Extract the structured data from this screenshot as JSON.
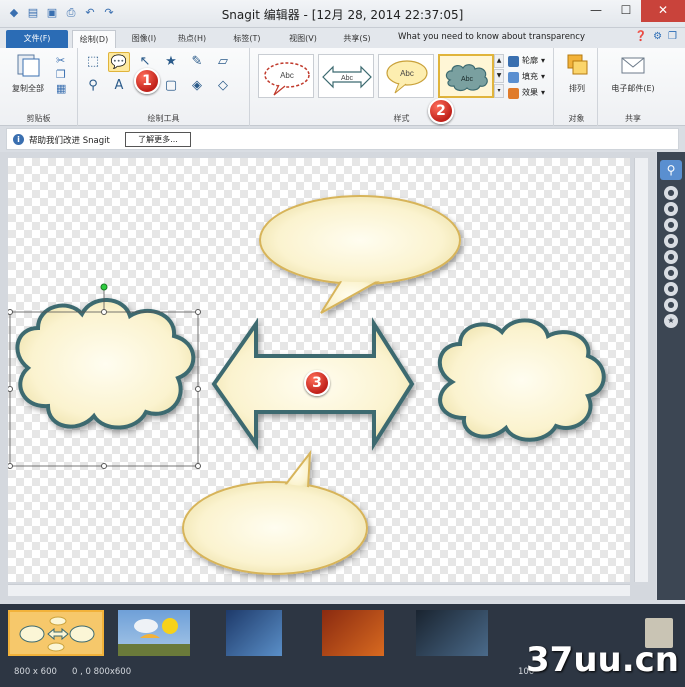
{
  "window": {
    "title": "Snagit 编辑器 - [12月 28, 2014 22:37:05]"
  },
  "tabs": [
    {
      "label": "文件(F)"
    },
    {
      "label": "绘制(D)"
    },
    {
      "label": "图像(I)"
    },
    {
      "label": "热点(H)"
    },
    {
      "label": "标签(T)"
    },
    {
      "label": "视图(V)"
    },
    {
      "label": "共享(S)"
    }
  ],
  "hint": "What you need to know about transparency",
  "ribbon": {
    "clipboard": {
      "label": "剪贴板",
      "copy_all": "复制全部"
    },
    "draw_tools": {
      "label": "绘制工具"
    },
    "styles": {
      "label": "样式",
      "sample_text": "Abc"
    },
    "options": {
      "outline": "轮廓",
      "fill": "填充",
      "effects": "效果"
    },
    "object": {
      "label": "对象",
      "arrange": "排列"
    },
    "share": {
      "label": "共享",
      "email": "电子邮件(E)"
    }
  },
  "message_bar": {
    "text": "帮助我们改进 Snagit",
    "button": "了解更多..."
  },
  "badges": [
    "1",
    "2",
    "3"
  ],
  "status": {
    "size": "800 x 600",
    "coords": "0 , 0  800x600",
    "zoom": "100"
  },
  "watermark": "37uu.cn",
  "colors": {
    "accent": "#2b6cb5",
    "shape_fill": "#fbf6d6",
    "shape_outline": "#3c6a70",
    "badge": "#d0281e"
  }
}
